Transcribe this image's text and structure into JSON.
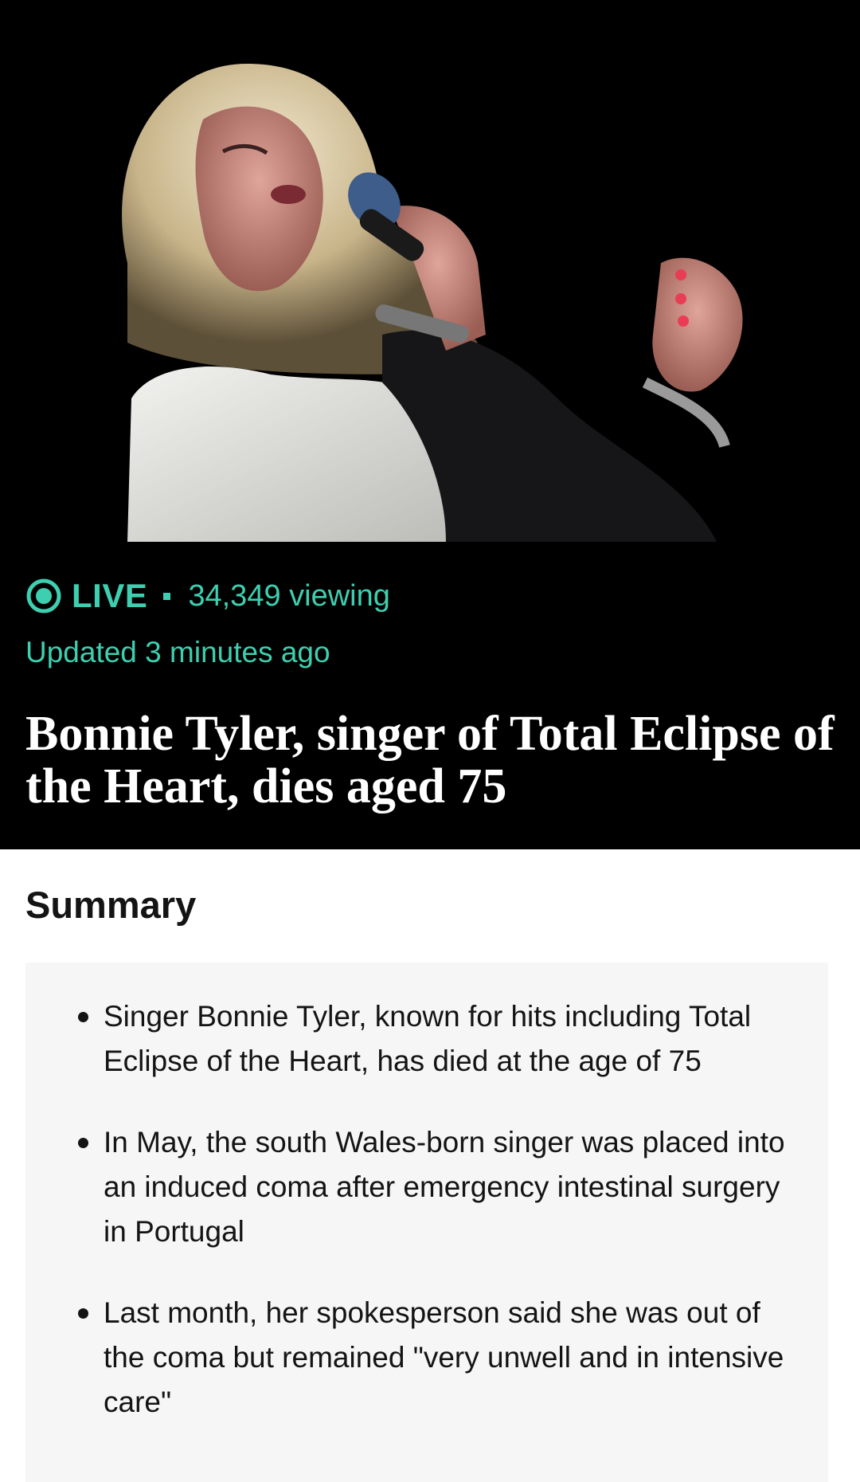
{
  "hero": {
    "image_alt": "Bonnie Tyler singing into a microphone on stage",
    "live_label": "LIVE",
    "viewing": "34,349 viewing",
    "updated": "Updated 3 minutes ago",
    "headline": "Bonnie Tyler, singer of Total Eclipse of the Heart, dies aged 75"
  },
  "summary": {
    "title": "Summary",
    "bullets": [
      "Singer Bonnie Tyler, known for hits including Total Eclipse of the Heart, has died at the age of 75",
      "In May, the south Wales-born singer was placed into an induced coma after emergency intestinal surgery in Portugal",
      "Last month, her spokesperson said she was out of the coma but remained \"very unwell and in intensive care\""
    ]
  },
  "colors": {
    "live_accent": "#3ecfb0",
    "hero_bg": "#000000",
    "summary_bg": "#f6f6f6",
    "text": "#141414"
  },
  "icons": {
    "live": "live-indicator-icon"
  }
}
